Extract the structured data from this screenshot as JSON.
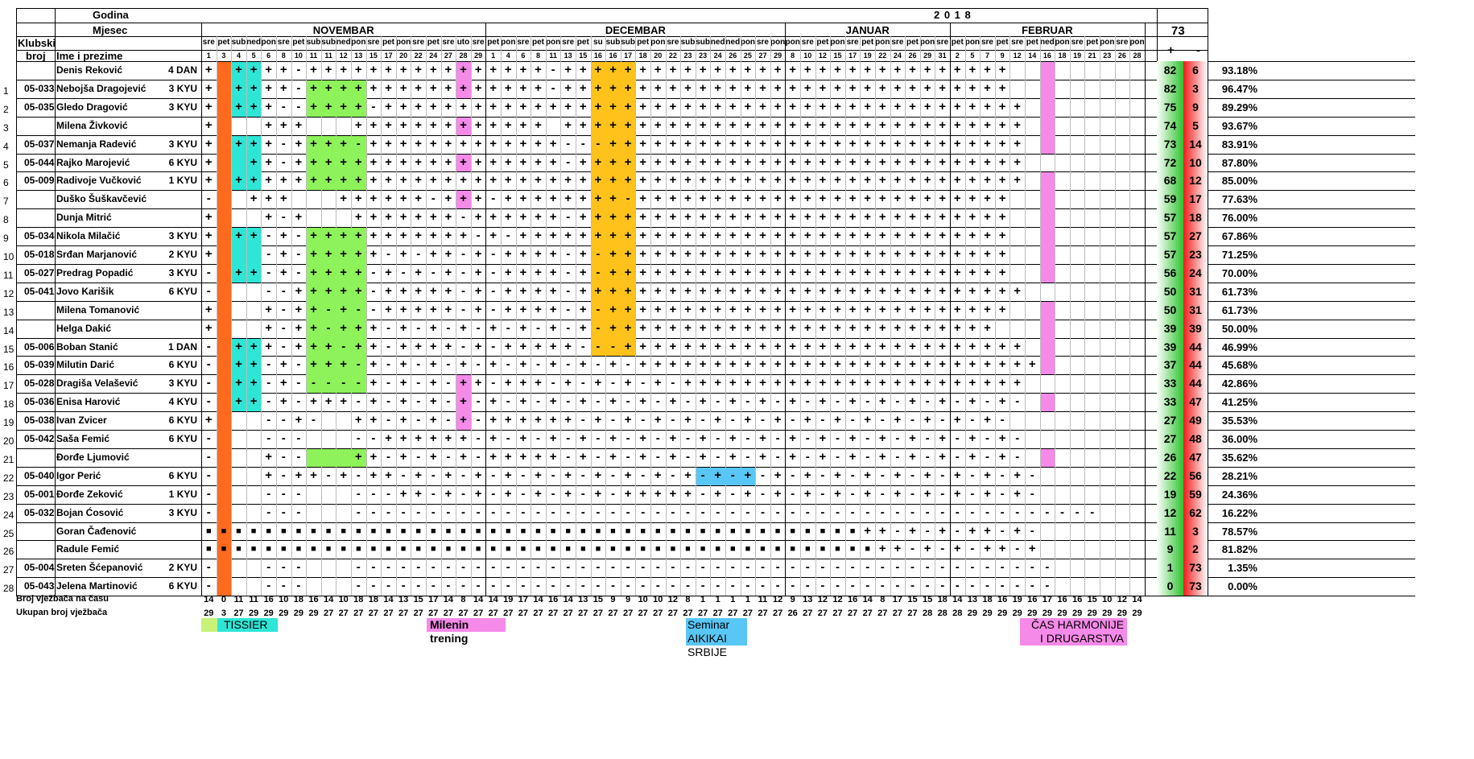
{
  "header": {
    "godina_label": "Godina",
    "year": "2 0 1 8",
    "mjesec_label": "Mjesec",
    "klubski_label_1": "Klubski",
    "klubski_label_2": "broj",
    "name_label": "Ime i prezime",
    "total_sessions": "73",
    "plus_label": "+",
    "minus_label": "-",
    "months": [
      {
        "name": "NOVEMBAR",
        "start": 0,
        "end": 19
      },
      {
        "name": "DECEMBAR",
        "start": 19,
        "end": 39
      },
      {
        "name": "JANUAR",
        "start": 39,
        "end": 50
      },
      {
        "name": "FEBRUAR",
        "start": 50,
        "end": 63
      }
    ],
    "weekdays": [
      "sre",
      "pet",
      "sub",
      "ned",
      "pon",
      "sre",
      "pet",
      "sub",
      "sub",
      "ned",
      "pon",
      "sre",
      "pet",
      "pon",
      "sre",
      "pet",
      "sre",
      "uto",
      "sre",
      "pet",
      "pon",
      "sre",
      "pet",
      "pon",
      "sre",
      "pet",
      "su",
      "sub",
      "sub",
      "pet",
      "pon",
      "sre",
      "sub",
      "sub",
      "ned",
      "ned",
      "pon",
      "sre",
      "pon",
      "pon",
      "sre",
      "pet",
      "pon",
      "sre",
      "pet",
      "pon",
      "sre",
      "pet",
      "pon",
      "sre",
      "pet",
      "pon",
      "sre",
      "pet",
      "sre",
      "pet",
      "ned",
      "pon",
      "sre",
      "pet",
      "pon",
      "sre",
      "pon"
    ],
    "dates": [
      "1",
      "3",
      "4",
      "5",
      "6",
      "8",
      "10",
      "11",
      "11",
      "12",
      "13",
      "15",
      "17",
      "20",
      "22",
      "24",
      "27",
      "28",
      "29",
      "1",
      "4",
      "6",
      "8",
      "11",
      "13",
      "15",
      "16",
      "16",
      "17",
      "18",
      "20",
      "22",
      "23",
      "23",
      "24",
      "26",
      "25",
      "27",
      "29",
      "8",
      "10",
      "12",
      "15",
      "17",
      "19",
      "22",
      "24",
      "26",
      "29",
      "31",
      "2",
      "5",
      "7",
      "9",
      "12",
      "14",
      "16",
      "18",
      "19",
      "21",
      "23",
      "26",
      "28"
    ]
  },
  "colors": {
    "orange": "#ff6a1f",
    "cyan": "#2ee6d6",
    "green": "#8ef25a",
    "yellow": "#ffc21a",
    "pink": "#f58ae8",
    "blue": "#58c7f5",
    "lime": "#c9f27a",
    "plus_grad": "#2ec22e",
    "minus_grad": "#f01b1b"
  },
  "members": [
    {
      "num": "",
      "club": "",
      "name": "Denis Reković",
      "rank": "4 DAN",
      "marks": "+ ++++-++++++++++++++++-++++++++++++++++++++++++++++++",
      "plus": "82",
      "minus": "6",
      "pct": "93.18%"
    },
    {
      "num": "1",
      "club": "05-033",
      "name": "Nebojša Dragojević",
      "rank": "3 KYU",
      "marks": "+ ++++-++++++++++++++++-++++++++++++++++++++++++++++++",
      "plus": "82",
      "minus": "3",
      "pct": "96.47%"
    },
    {
      "num": "2",
      "club": "05-035",
      "name": "Gledo Dragović",
      "rank": "3 KYU",
      "marks": "+ +++--++++-+++++++++++++++++++++++++++++++++++++++++++",
      "plus": "75",
      "minus": "9",
      "pct": "89.29%"
    },
    {
      "num": "3",
      "club": "",
      "name": "Milena Živković",
      "rank": "",
      "marks": "+   +++   +++++++++++++ +++++++++++++++++++++++++++++++",
      "plus": "74",
      "minus": "5",
      "pct": "93.67%"
    },
    {
      "num": "4",
      "club": "05-037",
      "name": "Nemanja Radević",
      "rank": "3 KYU",
      "marks": "+ +++-++++-+++++++++++++---++++++++++++++++++++++++++++",
      "plus": "73",
      "minus": "14",
      "pct": "83.91%"
    },
    {
      "num": "5",
      "club": "05-044",
      "name": "Rajko Marojević",
      "rank": "6 KYU",
      "marks": "+  ++-++++++++++++++++++-++++++++++++++++++++++++++++++",
      "plus": "72",
      "minus": "10",
      "pct": "87.80%"
    },
    {
      "num": "6",
      "club": "05-009",
      "name": "Radivoje Vučković",
      "rank": "1 KYU",
      "marks": "+ +++++++++++++++++++++++++++++++++++++++++++++++++++++",
      "plus": "68",
      "minus": "12",
      "pct": "85.00%"
    },
    {
      "num": "7",
      "club": "",
      "name": "Duško Šuškavčević",
      "rank": "",
      "marks": "-  +++   ++++++-+++-++++++++-+++++++++++++++++++++++++",
      "plus": "59",
      "minus": "17",
      "pct": "77.63%"
    },
    {
      "num": "8",
      "club": "",
      "name": "Dunja Mitrić",
      "rank": "",
      "marks": "+   +-+   +++++++-++++++-+++++++++++++++++++++++++++++",
      "plus": "57",
      "minus": "18",
      "pct": "76.00%"
    },
    {
      "num": "9",
      "club": "05-034",
      "name": "Nikola Milačić",
      "rank": "3 KYU",
      "marks": "+ ++-+-+++++++++++-+-+++++++++++++++++++++++++++++++++",
      "plus": "57",
      "minus": "27",
      "pct": "67.86%"
    },
    {
      "num": "10",
      "club": "05-018",
      "name": "Srđan Marjanović",
      "rank": "2 KYU",
      "marks": "+   -+-+++++-+-++-+-++++-+-+++++++++++++++++++++++++++",
      "plus": "57",
      "minus": "23",
      "pct": "71.25%"
    },
    {
      "num": "11",
      "club": "05-027",
      "name": "Predrag Popadić",
      "rank": "3 KYU",
      "marks": "- ++-+-++++-+-+-+-+-++++-+-+++++++++++++++++++++++++++",
      "plus": "56",
      "minus": "24",
      "pct": "70.00%"
    },
    {
      "num": "12",
      "club": "05-041",
      "name": "Jovo Karišik",
      "rank": "6 KYU",
      "marks": "-   --+++++-+++++-+-++++-++++++++++++++++++++++++++++++",
      "plus": "50",
      "minus": "31",
      "pct": "61.73%"
    },
    {
      "num": "13",
      "club": "",
      "name": "Milena Tomanović",
      "rank": "",
      "marks": "+   +-++-+--+++++-+-++++-+-+++++++++++++++++++++++++++",
      "plus": "50",
      "minus": "31",
      "pct": "61.73%"
    },
    {
      "num": "14",
      "club": "",
      "name": "Helga Dakić",
      "rank": "",
      "marks": "+   +-++-+++-+-+-+-+-+-+-+-++++++++++++++++++++++++++",
      "plus": "39",
      "minus": "39",
      "pct": "50.00%"
    },
    {
      "num": "15",
      "club": "05-006",
      "name": "Boban Stanić",
      "rank": "1 DAN",
      "marks": "- +++-+++-++-++++-+-+++++---+++++++++++++++++++++++++++",
      "plus": "39",
      "minus": "44",
      "pct": "46.99%"
    },
    {
      "num": "16",
      "club": "05-039",
      "name": "Milutin Darić",
      "rank": "6 KYU",
      "marks": "- ++-+-+++-+-+-+-+-+-+-+-+-+-+++++++++++++++++++++++++++",
      "plus": "37",
      "minus": "44",
      "pct": "45.68%"
    },
    {
      "num": "17",
      "club": "05-028",
      "name": "Dragiša Velašević",
      "rank": "3 KYU",
      "marks": "- ++-+-----+-+-+-++-+++-+-+-+-+-+++++++++++++++++++++++",
      "plus": "33",
      "minus": "44",
      "pct": "42.86%"
    },
    {
      "num": "18",
      "club": "05-036",
      "name": "Enisa Harović",
      "rank": "4 KYU",
      "marks": "- ++-+-+++-+-+-+-+-+-+-+-+-+-+-+-+-+-+-+-+-+-+-+-+-+-+-",
      "plus": "33",
      "minus": "47",
      "pct": "41.25%"
    },
    {
      "num": "19",
      "club": "05-038",
      "name": "Ivan Zvicer",
      "rank": "6 KYU",
      "marks": "+   --+-  ++-+-+-+-++++++-+-+-+-+-+-+-+-+-+-+-+-+-+-+-",
      "plus": "27",
      "minus": "49",
      "pct": "35.53%"
    },
    {
      "num": "20",
      "club": "05-042",
      "name": "Saša Femić",
      "rank": "6 KYU",
      "marks": "-   ---   --++++++-+-+-+-+-+-+-+-+-+-+-+-+-+-+-+-+-+-+-",
      "plus": "27",
      "minus": "48",
      "pct": "36.00%"
    },
    {
      "num": "21",
      "club": "",
      "name": "Đorđe Ljumović",
      "rank": "",
      "marks": "-   +--   ++-+-+-+-+++++-+-+-+-+-+-+-+-+-+-+-+-+-+-+-+-",
      "plus": "26",
      "minus": "47",
      "pct": "35.62%"
    },
    {
      "num": "22",
      "club": "05-040",
      "name": "Igor Perić",
      "rank": "6 KYU",
      "marks": "-   +-++-+-++-+-+-+-+-+-+-+-+-+-+-+-+-+-+-+-+-+-+-+-+-+-",
      "plus": "22",
      "minus": "56",
      "pct": "28.21%"
    },
    {
      "num": "23",
      "club": "05-001",
      "name": "Đorđe Zeković",
      "rank": "1 KYU",
      "marks": "-   ---   ---++-+-+-+-+-+-+-+++++-+-+-+-+-+-+-+-+-+-+-+-",
      "plus": "19",
      "minus": "59",
      "pct": "24.36%"
    },
    {
      "num": "24",
      "club": "05-032",
      "name": "Bojan Ćosović",
      "rank": "3 KYU",
      "marks": "-   ---   --------------------------------------------------",
      "plus": "12",
      "minus": "62",
      "pct": "16.22%"
    },
    {
      "num": "25",
      "club": "",
      "name": "Goran Čađenović",
      "rank": "",
      "marks": "■■■■■■■■■■■■■■■■■■■■■■■■■■■■■■■■■■■■■■■■■■■■++-+-+-++-+-",
      "plus": "11",
      "minus": "3",
      "pct": "78.57%"
    },
    {
      "num": "26",
      "club": "",
      "name": "Radule Femić",
      "rank": "",
      "marks": "■■■■■■■■■■■■■■■■■■■■■■■■■■■■■■■■■■■■■■■■■■■■■++-+-+-++-+",
      "plus": "9",
      "minus": "2",
      "pct": "81.82%"
    },
    {
      "num": "27",
      "club": "05-004",
      "name": "Sreten Šćepanović",
      "rank": "2 KYU",
      "marks": "-   ---   -----------------------------------------------",
      "plus": "1",
      "minus": "73",
      "pct": "1.35%"
    },
    {
      "num": "28",
      "club": "05-043",
      "name": "Jelena Martinović",
      "rank": "6 KYU",
      "marks": "-   ---   -----------------------------------------------",
      "plus": "0",
      "minus": "73",
      "pct": "0.00%"
    }
  ],
  "footer": {
    "broj_label": "Broj vježbača na času",
    "ukupan_label": "Ukupan broj vježbača",
    "broj_values": [
      "14",
      "0",
      "11",
      "11",
      "16",
      "10",
      "18",
      "16",
      "14",
      "10",
      "18",
      "18",
      "14",
      "13",
      "15",
      "17",
      "14",
      "8",
      "14",
      "14",
      "19",
      "17",
      "14",
      "16",
      "14",
      "13",
      "15",
      "9",
      "9",
      "10",
      "10",
      "12",
      "8",
      "1",
      "1",
      "1",
      "1",
      "11",
      "12",
      "9",
      "13",
      "12",
      "12",
      "16",
      "14",
      "8",
      "17",
      "15",
      "15",
      "18",
      "14",
      "13",
      "18",
      "16",
      "19",
      "16",
      "17",
      "16",
      "16",
      "15",
      "10",
      "12",
      "14"
    ],
    "ukupan_values": [
      "29",
      "3",
      "27",
      "29",
      "29",
      "29",
      "29",
      "29",
      "27",
      "27",
      "27",
      "27",
      "27",
      "27",
      "27",
      "27",
      "27",
      "27",
      "27",
      "27",
      "27",
      "27",
      "27",
      "27",
      "27",
      "27",
      "27",
      "27",
      "27",
      "27",
      "27",
      "27",
      "27",
      "27",
      "27",
      "27",
      "27",
      "27",
      "27",
      "26",
      "27",
      "27",
      "27",
      "27",
      "27",
      "27",
      "27",
      "27",
      "28",
      "28",
      "28",
      "29",
      "29",
      "29",
      "29",
      "29",
      "29",
      "29",
      "29",
      "29",
      "29",
      "29",
      "29"
    ]
  },
  "legend": {
    "tissier": "TISSIER",
    "milenin": "Milenin trening",
    "seminar_1": "Seminar",
    "seminar_2": "AIKIKAI SRBIJE",
    "cas_1": "ČAS HARMONIJE",
    "cas_2": "I DRUGARSTVA"
  }
}
